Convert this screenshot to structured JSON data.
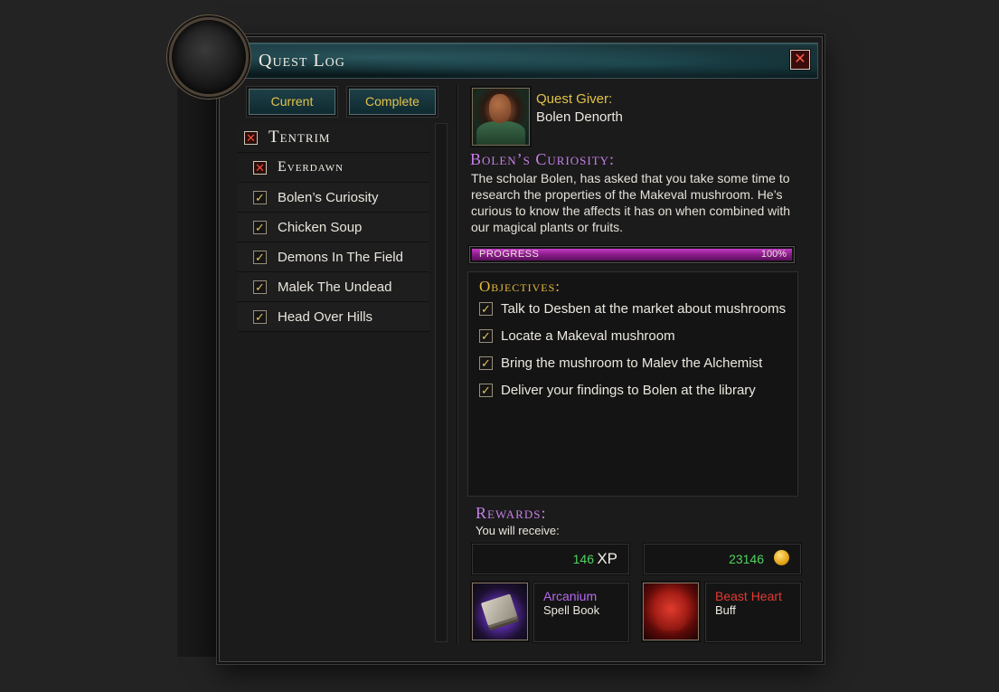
{
  "window": {
    "title": "Quest Log",
    "close_glyph": "✕"
  },
  "filters": {
    "current_label": "Current",
    "complete_label": "Complete"
  },
  "quest_list": {
    "zones": [
      {
        "label": "Tentrim",
        "state": "x"
      },
      {
        "label": "Everdawn",
        "state": "x"
      }
    ],
    "quests": [
      {
        "label": "Bolen’s Curiosity",
        "state": "checked"
      },
      {
        "label": "Chicken Soup",
        "state": "checked"
      },
      {
        "label": "Demons In The Field",
        "state": "checked"
      },
      {
        "label": "Malek The Undead",
        "state": "checked"
      },
      {
        "label": "Head Over Hills",
        "state": "checked"
      }
    ]
  },
  "detail": {
    "giver_label": "Quest Giver:",
    "giver_name": "Bolen Denorth",
    "quest_title": "Bolen’s Curiosity:",
    "description": "The scholar Bolen, has asked that you take some time to research the properties of the Makeval mushroom. He’s curious to know the affects it has on when combined with our magical plants or fruits.",
    "progress_label": "PROGRESS",
    "progress_text": "100%",
    "progress_fraction": 1.0
  },
  "objectives": {
    "title": "Objectives:",
    "items": [
      {
        "text": "Talk to Desben at the market about mushrooms",
        "done": true
      },
      {
        "text": "Locate a Makeval mushroom",
        "done": true
      },
      {
        "text": "Bring the mushroom to Malev the Alchemist",
        "done": true
      },
      {
        "text": "Deliver your findings to Bolen at the library",
        "done": true
      }
    ]
  },
  "rewards": {
    "title": "Rewards:",
    "subtitle": "You will receive:",
    "xp_amount": "146",
    "xp_label": "XP",
    "gold_amount": "23146",
    "items": [
      {
        "name": "Arcanium",
        "type": "Spell Book",
        "icon": "spell-book-icon",
        "color": "#b66af0"
      },
      {
        "name": "Beast Heart",
        "type": "Buff",
        "icon": "beast-heart-icon",
        "color": "#e23a32"
      }
    ]
  },
  "colors": {
    "accent_gold": "#e3c34a",
    "accent_purple": "#c77fe8",
    "progress_fill": "#a52aa5",
    "reward_green": "#4fd25e"
  },
  "check_glyph": "✓",
  "x_glyph": "✕"
}
